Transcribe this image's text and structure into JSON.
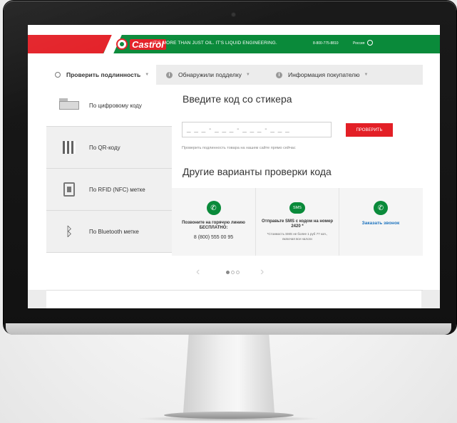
{
  "header": {
    "brand": "Castrol",
    "tagline": "IT'S MORE THAN JUST OIL. IT'S LIQUID ENGINEERING.",
    "phone": "8-800-775-8810",
    "region": "Россия"
  },
  "tabs": [
    {
      "label": "Проверить подлинность"
    },
    {
      "label": "Обнаружили подделку"
    },
    {
      "label": "Информация покупателю"
    }
  ],
  "sidebar": {
    "items": [
      {
        "label": "По цифровому коду"
      },
      {
        "label": "По QR-коду"
      },
      {
        "label": "По RFID (NFC) метке"
      },
      {
        "label": "По Bluetooth метке"
      }
    ]
  },
  "main": {
    "title": "Введите код со стикера",
    "code_placeholder": "_ _ _ - _ _ _ - _ _ _ - _ _ _",
    "check_button": "ПРОВЕРИТЬ",
    "hint": "Проверить подлинность товара на нашем сайте прямо сейчас",
    "other_title": "Другие варианты проверки кода",
    "options": [
      {
        "title": "Позвоните на горячую линию БЕСПЛАТНО:",
        "value": "8 (800) 555 00 95"
      },
      {
        "icon_text": "SMS",
        "title": "Отправьте SMS с кодом на номер 2420 *",
        "note": "*Стоимость SMS не более 1 руб 77 коп., включая все налоги"
      },
      {
        "title": "Заказать звонок"
      }
    ]
  },
  "carousel": {
    "prev": "‹",
    "next": "›",
    "active_index": 0,
    "count": 3
  },
  "colors": {
    "brand_green": "#0a8a3a",
    "brand_red": "#e31f26",
    "link_blue": "#1e73be"
  }
}
